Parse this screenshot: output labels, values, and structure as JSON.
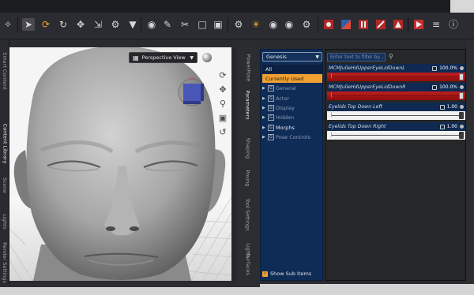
{
  "toolbar": {
    "icons": [
      "cursor-icon",
      "rotate-node-icon",
      "universal-tool-icon",
      "move-icon",
      "scale-icon",
      "joint-editor-icon",
      "triangle-icon",
      "surface-selection-icon",
      "brush-icon",
      "geometry-tool-icon",
      "shape-icon",
      "render-settings-icon",
      "light-icon",
      "camera-icon",
      "spot-render-icon",
      "settings-icon",
      "morph-icon",
      "content-icon",
      "fill-icon",
      "edit-icon",
      "render-icon",
      "menu-icon",
      "info-icon"
    ]
  },
  "left_tabs": [
    {
      "label": "Smart Content"
    },
    {
      "label": "Content Library"
    },
    {
      "label": "Scene"
    },
    {
      "label": "Lights"
    },
    {
      "label": "Render Settings"
    }
  ],
  "viewport": {
    "view_label": "Perspective View"
  },
  "panel_tabs": [
    {
      "label": "PowerPose"
    },
    {
      "label": "Parameters"
    },
    {
      "label": "Shaping"
    },
    {
      "label": "Posing"
    },
    {
      "label": "Tool Settings"
    },
    {
      "label": "Lights"
    },
    {
      "label": "Surfaces"
    }
  ],
  "tree": {
    "figure": "Genesis",
    "categories": [
      {
        "label": "All"
      },
      {
        "label": "Currently Used"
      }
    ],
    "groups": [
      {
        "label": "General"
      },
      {
        "label": "Actor"
      },
      {
        "label": "Display"
      },
      {
        "label": "Hidden"
      },
      {
        "label": "Morphs"
      },
      {
        "label": "Pose Controls"
      }
    ],
    "show_sub_items": "Show Sub Items"
  },
  "properties": {
    "filter_placeholder": "Enter text to filter by...",
    "items": [
      {
        "name": "MCMJulieHdUpperEyeLidDownL",
        "value": "100.0%",
        "fraction": 1.0
      },
      {
        "name": "MCMJulieHdUpperEyeLidDownR",
        "value": "100.0%",
        "fraction": 1.0
      },
      {
        "name": "Eyelids Top Down Left",
        "value": "1.00",
        "fraction": 1.0
      },
      {
        "name": "Eyelids Top Down Right",
        "value": "1.00",
        "fraction": 1.0
      }
    ]
  },
  "colors": {
    "accent": "#f0a031",
    "tree_bg": "#0f2c57",
    "slider_red": "#b31818"
  }
}
